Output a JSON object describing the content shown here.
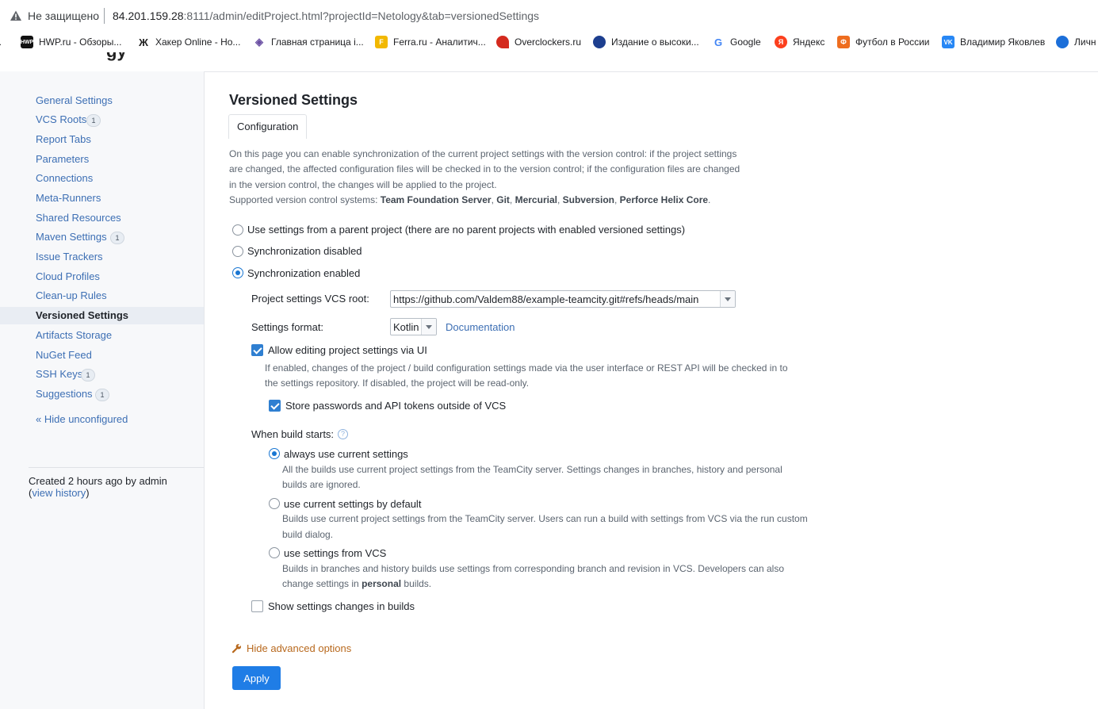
{
  "browser": {
    "security_label": "Не защищено",
    "url_host": "84.201.159.28",
    "url_rest": ":8111/admin/editProject.html?projectId=Netology&tab=versionedSettings",
    "bookmarks": [
      {
        "label": "...",
        "icon": "bookmark-fragment-icon",
        "color": "#5f6368"
      },
      {
        "label": "HWP.ru - Обзоры...",
        "icon": "hwp-icon",
        "color": "#111111"
      },
      {
        "label": "Хакер Online - Но...",
        "icon": "xakep-icon",
        "color": "#222222"
      },
      {
        "label": "Главная страница i...",
        "icon": "ixbt-icon",
        "color": "#6a4fa3"
      },
      {
        "label": "Ferra.ru - Аналитич...",
        "icon": "ferra-icon",
        "color": "#f2b800"
      },
      {
        "label": "Overclockers.ru",
        "icon": "overclockers-icon",
        "color": "#d42a1e"
      },
      {
        "label": "Издание о высоки...",
        "icon": "izdanie-icon",
        "color": "#1d3f8f"
      },
      {
        "label": "Google",
        "icon": "google-icon",
        "color": "#4285f4"
      },
      {
        "label": "Яндекс",
        "icon": "yandex-icon",
        "color": "#fc3f1d"
      },
      {
        "label": "Футбол в России",
        "icon": "football-icon",
        "color": "#ee6d1f"
      },
      {
        "label": "Владимир Яковлев",
        "icon": "vk-icon",
        "color": "#2787f5"
      },
      {
        "label": "Личн",
        "icon": "personal-icon",
        "color": "#1c6fd9"
      }
    ]
  },
  "sidebar": {
    "items": [
      {
        "label": "General Settings"
      },
      {
        "label": "VCS Roots",
        "badge": "1"
      },
      {
        "label": "Report Tabs"
      },
      {
        "label": "Parameters"
      },
      {
        "label": "Connections"
      },
      {
        "label": "Meta-Runners"
      },
      {
        "label": "Shared Resources"
      },
      {
        "label": "Maven Settings",
        "badge": "1"
      },
      {
        "label": "Issue Trackers"
      },
      {
        "label": "Cloud Profiles"
      },
      {
        "label": "Clean-up Rules"
      },
      {
        "label": "Versioned Settings",
        "active": true
      },
      {
        "label": "Artifacts Storage"
      },
      {
        "label": "NuGet Feed"
      },
      {
        "label": "SSH Keys",
        "badge": "1"
      },
      {
        "label": "Suggestions",
        "badge": "1"
      }
    ],
    "hide_unconfigured": "« Hide unconfigured",
    "created": "Created 2 hours ago by admin",
    "view_history_open": "(",
    "view_history": "view history",
    "view_history_close": ")"
  },
  "main": {
    "title": "Versioned Settings",
    "tab": "Configuration",
    "intro_line1": "On this page you can enable synchronization of the current project settings with the version control: if the project settings",
    "intro_line2": "are changed, the affected configuration files will be checked in to the version control; if the configuration files are changed",
    "intro_line3": "in the version control, the changes will be applied to the project.",
    "supported_prefix": "Supported version control systems: ",
    "supported_systems": [
      "Team Foundation Server",
      "Git",
      "Mercurial",
      "Subversion",
      "Perforce Helix Core"
    ],
    "sync_options": [
      {
        "label": "Use settings from a parent project (there are no parent projects with enabled versioned settings)",
        "selected": false
      },
      {
        "label": "Synchronization disabled",
        "selected": false
      },
      {
        "label": "Synchronization enabled",
        "selected": true
      }
    ],
    "vcs_root_label": "Project settings VCS root:",
    "vcs_root_value": "https://github.com/Valdem88/example-teamcity.git#refs/heads/main",
    "format_label": "Settings format:",
    "format_value": "Kotlin",
    "documentation_link": "Documentation",
    "allow_editing_label": "Allow editing project settings via UI",
    "allow_editing_checked": true,
    "allow_editing_desc1": "If enabled, changes of the project / build configuration settings made via the user interface or REST API will be checked in to",
    "allow_editing_desc2": "the settings repository. If disabled, the project will be read-only.",
    "store_passwords_label": "Store passwords and API tokens outside of VCS",
    "store_passwords_checked": true,
    "when_build_starts_label": "When build starts:",
    "build_options": [
      {
        "label": "always use current settings",
        "selected": true,
        "desc1": "All the builds use current project settings from the TeamCity server. Settings changes in branches, history and personal",
        "desc2": "builds are ignored."
      },
      {
        "label": "use current settings by default",
        "selected": false,
        "desc1": "Builds use current project settings from the TeamCity server. Users can run a build with settings from VCS via the run custom",
        "desc2": "build dialog."
      },
      {
        "label": "use settings from VCS",
        "selected": false,
        "desc1": "Builds in branches and history builds use settings from corresponding branch and revision in VCS. Developers can also",
        "desc2_prefix": "change settings in ",
        "desc2_bold": "personal",
        "desc2_suffix": " builds."
      }
    ],
    "show_changes_label": "Show settings changes in builds",
    "show_changes_checked": false,
    "advanced_link": "Hide advanced options",
    "apply_button": "Apply"
  },
  "colors": {
    "link": "#3d6fb4",
    "accent": "#1f7de6",
    "advanced_link": "#b8691e",
    "sidebar_bg": "#f7f8fa"
  }
}
